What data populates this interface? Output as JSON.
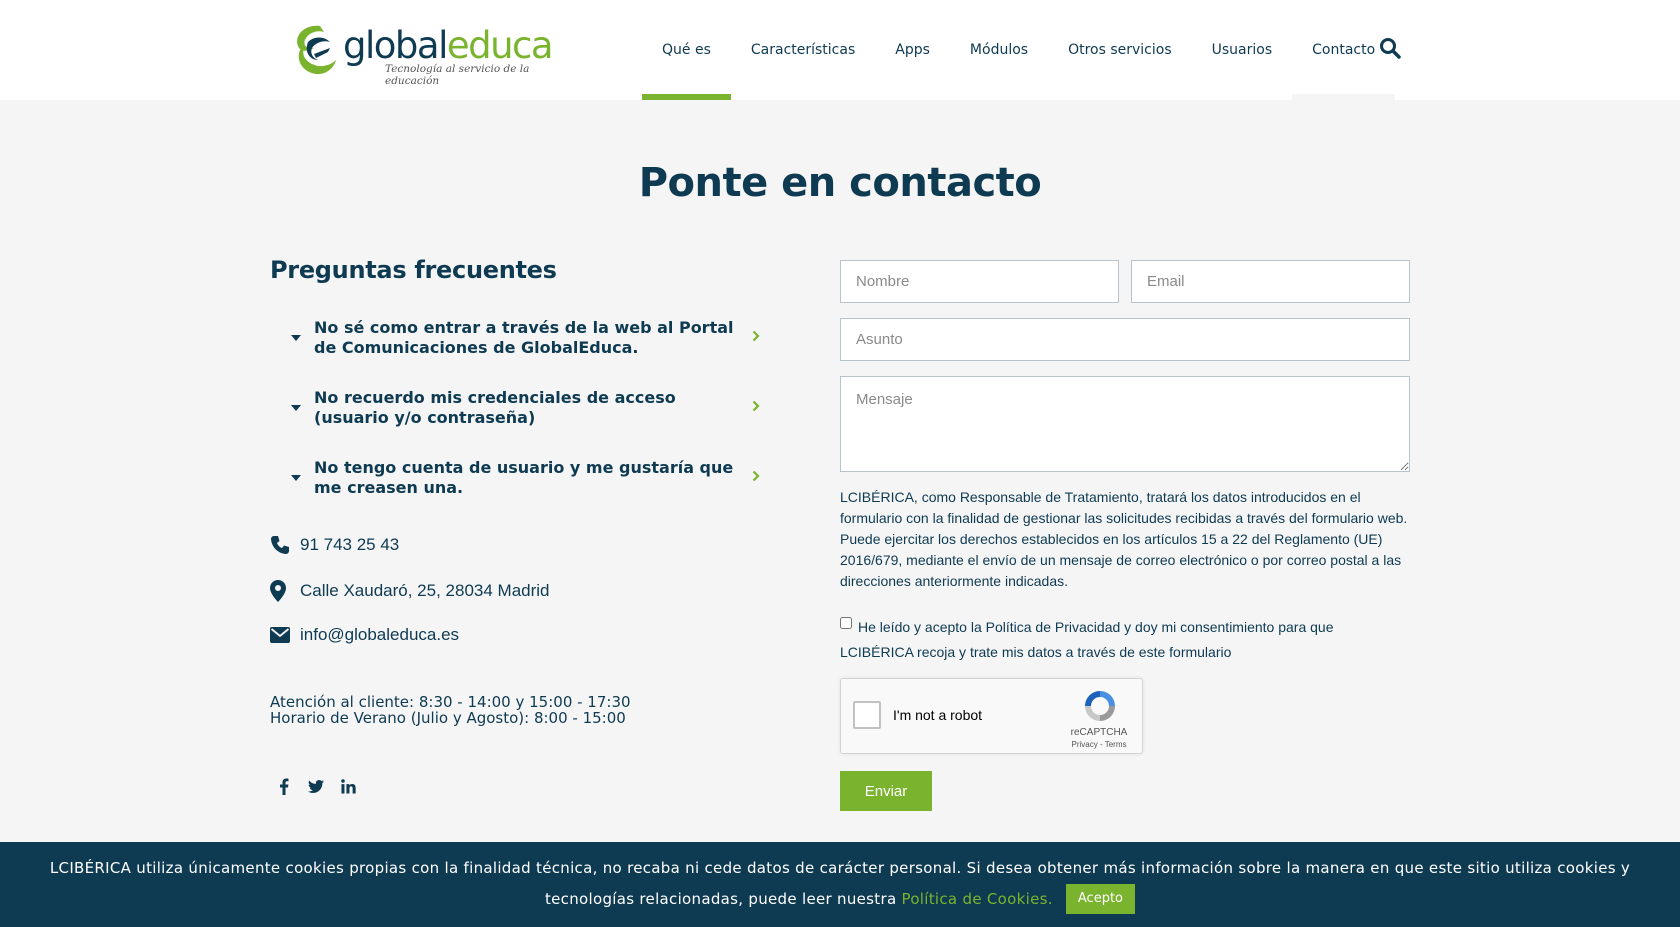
{
  "header": {
    "logo_text_1": "global",
    "logo_text_2": "educa",
    "logo_tagline": "Tecnología al servicio de la educación",
    "nav": [
      "Qué es",
      "Características",
      "Apps",
      "Módulos",
      "Otros servicios",
      "Usuarios",
      "Contacto"
    ],
    "active_nav": "Qué es",
    "search_icon": "search-icon"
  },
  "page": {
    "title": "Ponte en contacto"
  },
  "faq": {
    "title": "Preguntas frecuentes",
    "items": [
      "No sé como entrar a través de la web al Portal de Comunicaciones de GlobalEduca.",
      "No recuerdo mis credenciales de acceso (usuario y/o contraseña)",
      "No tengo cuenta de usuario y me gustaría que me creasen una."
    ]
  },
  "contact": {
    "phone": "91 743 25 43",
    "address": "Calle Xaudaró, 25, 28034 Madrid",
    "email": "info@globaleduca.es",
    "hours_1": "Atención al cliente: 8:30 - 14:00 y 15:00 - 17:30",
    "hours_2": "Horario de Verano (Julio y Agosto): 8:00 - 15:00",
    "social": [
      "facebook-icon",
      "twitter-icon",
      "linkedin-icon"
    ]
  },
  "form": {
    "name_placeholder": "Nombre",
    "email_placeholder": "Email",
    "subject_placeholder": "Asunto",
    "message_placeholder": "Mensaje",
    "legal_text": "LCIBÉRICA, como Responsable de Tratamiento, tratará los datos introducidos en el formulario con la finalidad de gestionar las solicitudes recibidas a través del formulario web. Puede ejercitar los derechos establecidos en los artículos 15 a 22 del Reglamento (UE) 2016/679, mediante el envío de un mensaje de correo electrónico o por correo postal a las direcciones anteriormente indicadas.",
    "consent_text": "He leído y acepto la Política de Privacidad y doy mi consentimiento para que LCIBÉRICA recoja y trate mis datos a través de este formulario",
    "consent_checked": false,
    "captcha_label": "I'm not a robot",
    "captcha_brand": "reCAPTCHA",
    "captcha_links": "Privacy - Terms",
    "submit_label": "Enviar"
  },
  "cookie_bar": {
    "text": "LCIBÉRICA utiliza únicamente cookies propias con la finalidad técnica, no recaba ni cede datos de carácter personal. Si desea obtener más información sobre la manera en que este sitio utiliza cookies y tecnologías relacionadas, puede leer nuestra",
    "link_text": "Política de Cookies.",
    "accept_label": "Acepto"
  },
  "colors": {
    "primary": "#0e3a52",
    "accent": "#7ab32e",
    "background": "#f5f5f5"
  }
}
